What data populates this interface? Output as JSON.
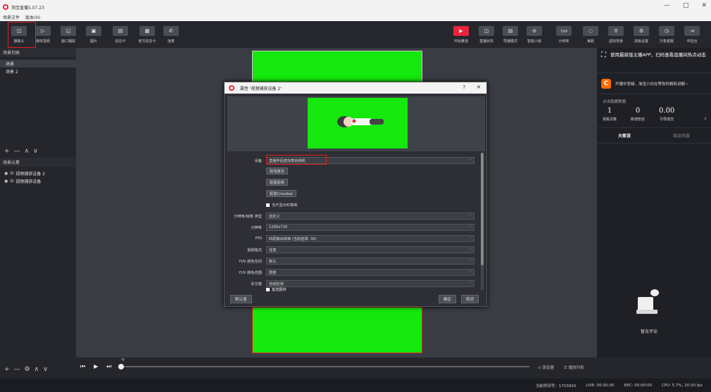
{
  "app": {
    "title": "淘宝直播5.07.23",
    "menu": [
      "场景文件",
      "版本(H)"
    ]
  },
  "window": {
    "minimize": "—",
    "maximize": "□",
    "close": "✕"
  },
  "toolbar": {
    "left": [
      {
        "label": "摄像头",
        "icon": "camera-icon",
        "glyph": "◫"
      },
      {
        "label": "媒体视频",
        "icon": "play-icon",
        "glyph": "▷"
      },
      {
        "label": "窗口捕获",
        "icon": "window-icon",
        "glyph": "◱"
      },
      {
        "label": "图片",
        "icon": "image-icon",
        "glyph": "▣"
      },
      {
        "label": "信息卡",
        "icon": "card-icon",
        "glyph": "▤"
      },
      {
        "label": "官方信息卡",
        "icon": "official-card-icon",
        "glyph": "▦"
      },
      {
        "label": "连麦",
        "icon": "phone-icon",
        "glyph": "✆"
      }
    ],
    "right": [
      {
        "label": "开始推流",
        "icon": "start-stream-icon",
        "glyph": "▶"
      },
      {
        "label": "直播状态",
        "icon": "status-icon",
        "glyph": "◫"
      },
      {
        "label": "导播模式",
        "icon": "director-icon",
        "glyph": "▤"
      },
      {
        "label": "智能小窗",
        "icon": "mini-window-icon",
        "glyph": "⊖"
      },
      {
        "label": "分辨率",
        "icon": "resolution-icon",
        "glyph": "720P"
      },
      {
        "label": "美颜",
        "icon": "beauty-icon",
        "glyph": "◌"
      },
      {
        "label": "虚拟背景",
        "icon": "virtual-bg-icon",
        "glyph": "⚲"
      },
      {
        "label": "高级设置",
        "icon": "settings-icon",
        "glyph": "⚙"
      },
      {
        "label": "万象客服",
        "icon": "service-icon",
        "glyph": "◷"
      },
      {
        "label": "中控台",
        "icon": "console-icon",
        "glyph": "⇥"
      }
    ]
  },
  "scenes": {
    "title": "场景列表",
    "items": [
      "场景",
      "场景 2"
    ],
    "controls": [
      "+",
      "—",
      "∧",
      "∨"
    ]
  },
  "sources": {
    "title": "场景元素",
    "items": [
      "视频捕获设备 2",
      "视频捕获设备"
    ],
    "controls": [
      "+",
      "—",
      "⚙",
      "∧",
      "∨"
    ]
  },
  "right_panel": {
    "promo_text": "使用最新版主播APP，扫码查看直播间热点动态",
    "promo2_text": "开播中答疑，淘宝小白在等你的精彩讲解~",
    "stats_title": "点击隐藏数据",
    "stats": [
      {
        "value": "1",
        "label": "观看次数"
      },
      {
        "value": "0",
        "label": "新增粉丝"
      },
      {
        "value": "0.00",
        "label": "引导成交"
      }
    ],
    "tabs": [
      "大家说",
      "商品热度"
    ],
    "empty_text": "暂无评论"
  },
  "dialog": {
    "title": "属性 '视频捕获设备 2'",
    "help": "?",
    "close": "✕",
    "rows": [
      {
        "label": "设备",
        "value": "直播伴侣虚拟角色相机"
      },
      {
        "label": "分辨率/帧率 类型",
        "value": "自定义"
      },
      {
        "label": "分辨率",
        "value": "1280x720"
      },
      {
        "label": "FPS",
        "value": "匹配输出帧率 (当前选择: 30)"
      },
      {
        "label": "视频格式",
        "value": "任意"
      },
      {
        "label": "YUV 颜色空间",
        "value": "默认"
      },
      {
        "label": "YUV 颜色范围",
        "value": "局部"
      },
      {
        "label": "反交错",
        "value": "自动检测"
      }
    ],
    "buttons": [
      "取消激活",
      "配置视频",
      "配置Crossbar"
    ],
    "checkbox1": "当不显示时禁用",
    "checkbox2": "垂直翻转",
    "defaults": "默认值",
    "ok": "确定",
    "cancel": "取消"
  },
  "player": {
    "controls": [
      "⏮",
      "▶",
      "⏭"
    ],
    "mixer": [
      "⊙ 混音器",
      "☰ 播放列表"
    ]
  },
  "status": {
    "room": "当前房间号：1753920",
    "live": "LIVE: 00:00:00",
    "rec": "REC: 00:00:00",
    "cpu": "CPU: 5.7%, 20.00 fps"
  }
}
